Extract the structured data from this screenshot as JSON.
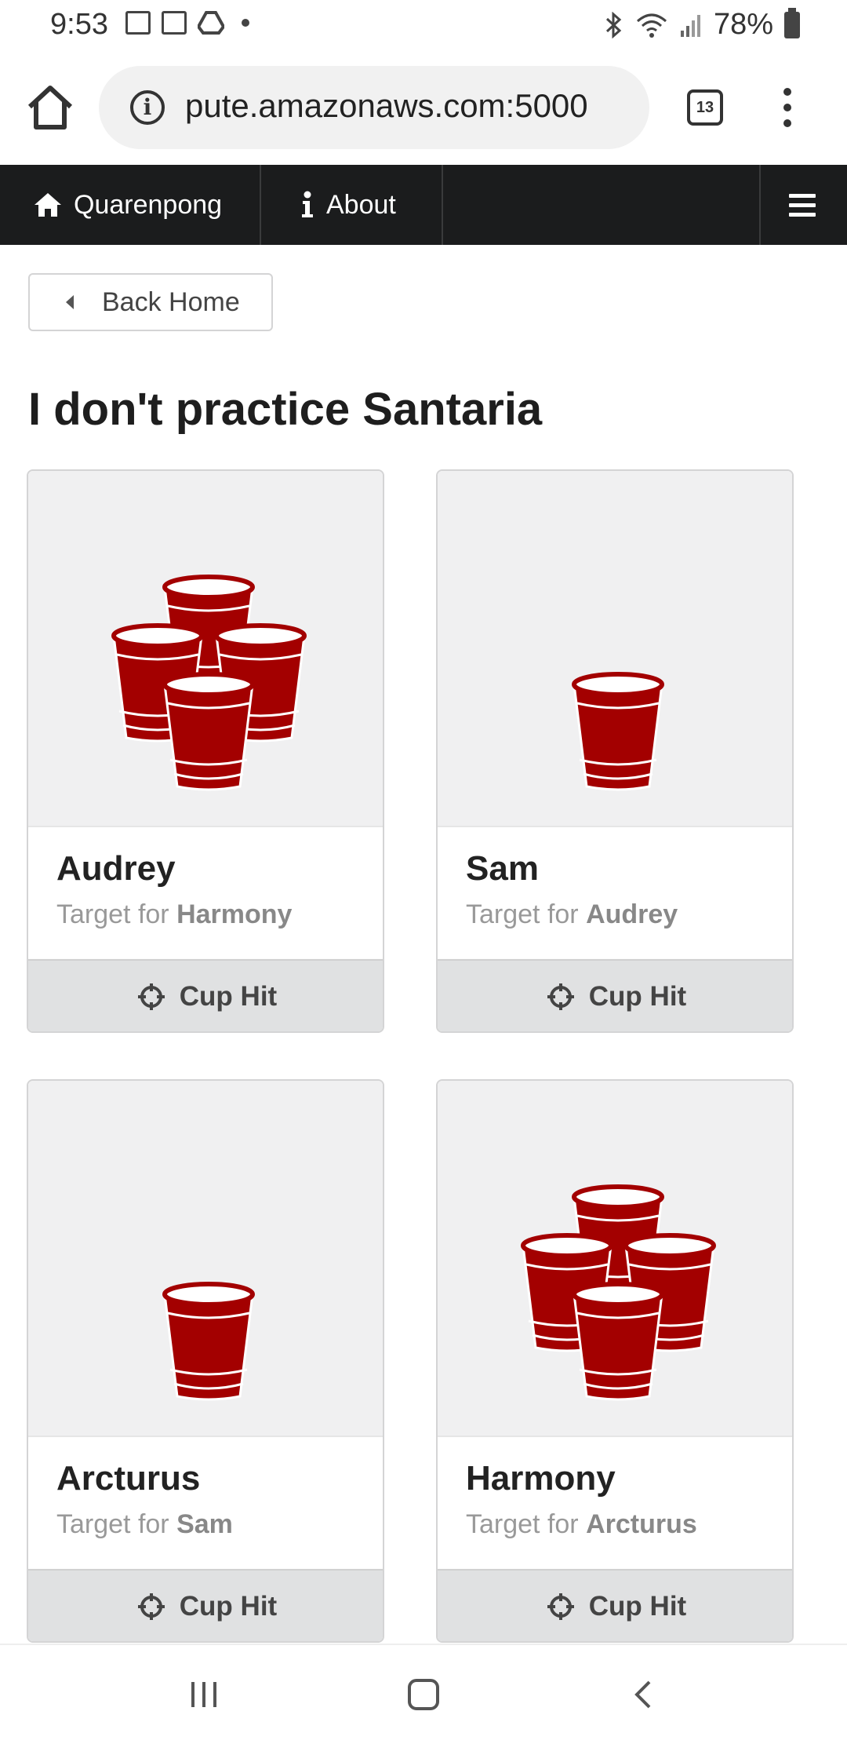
{
  "status_bar": {
    "time": "9:53",
    "battery": "78%"
  },
  "browser": {
    "url": "pute.amazonaws.com:5000",
    "tab_count": "13"
  },
  "navbar": {
    "brand": "Quarenpong",
    "about": "About"
  },
  "back_button": {
    "label": "Back Home"
  },
  "page_title": "I don't practice Santaria",
  "cards": [
    {
      "name": "Audrey",
      "target_prefix": "Target for",
      "target": "Harmony",
      "action": "Cup Hit",
      "cups": 4
    },
    {
      "name": "Sam",
      "target_prefix": "Target for",
      "target": "Audrey",
      "action": "Cup Hit",
      "cups": 1
    },
    {
      "name": "Arcturus",
      "target_prefix": "Target for",
      "target": "Sam",
      "action": "Cup Hit",
      "cups": 1
    },
    {
      "name": "Harmony",
      "target_prefix": "Target for",
      "target": "Arcturus",
      "action": "Cup Hit",
      "cups": 4
    }
  ],
  "colors": {
    "cup_red": "#a30000",
    "navbar_bg": "#1b1c1d"
  },
  "icons": {
    "home": "home-icon",
    "info": "info-icon",
    "crosshairs": "crosshairs-icon",
    "cup": "cup-icon"
  }
}
